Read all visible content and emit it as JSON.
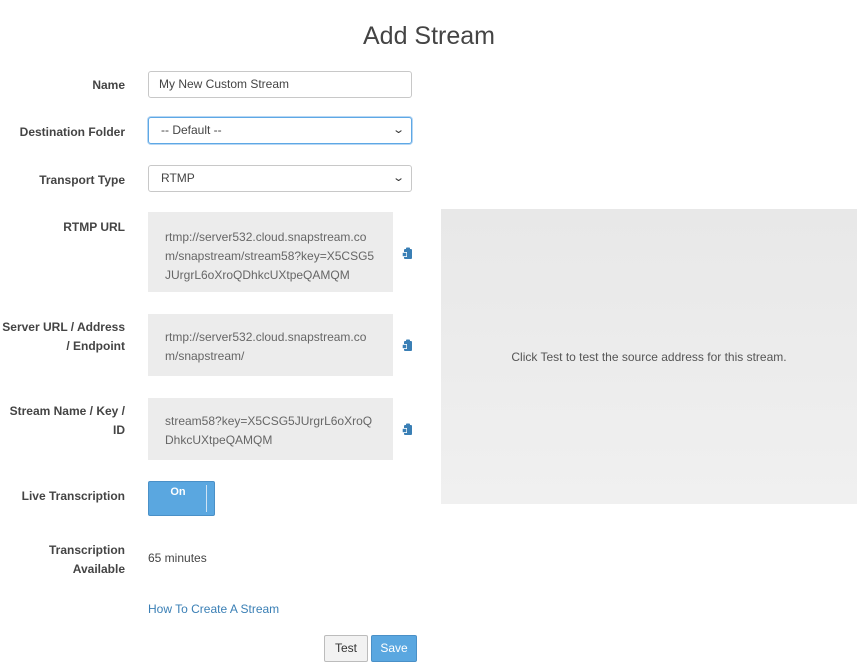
{
  "page": {
    "title": "Add Stream"
  },
  "form": {
    "name": {
      "label": "Name",
      "value": "My New Custom Stream"
    },
    "destination_folder": {
      "label": "Destination Folder",
      "value": "-- Default --"
    },
    "transport_type": {
      "label": "Transport Type",
      "value": "RTMP"
    },
    "rtmp_url": {
      "label": "RTMP URL",
      "value": "rtmp://server532.cloud.snapstream.com/snapstream/stream58?key=X5CSG5JUrgrL6oXroQDhkcUXtpeQAMQM"
    },
    "server_url": {
      "label": "Server URL / Address / Endpoint",
      "value": "rtmp://server532.cloud.snapstream.com/snapstream/"
    },
    "stream_name": {
      "label": "Stream Name / Key / ID",
      "value": "stream58?key=X5CSG5JUrgrL6oXroQDhkcUXtpeQAMQM"
    },
    "live_transcription": {
      "label": "Live Transcription",
      "state": "On"
    },
    "transcription_available": {
      "label": "Transcription Available",
      "value": "65 minutes"
    }
  },
  "preview": {
    "message": "Click Test to test the source address for this stream."
  },
  "links": {
    "how_to": "How To Create A Stream"
  },
  "buttons": {
    "test": "Test",
    "save": "Save"
  },
  "icons": {
    "copy": "clipboard-copy-icon",
    "dropdown": "chevron-down-icon"
  },
  "colors": {
    "accent": "#5aa7e0",
    "link": "#3a7fb5",
    "readonly_bg": "#ececec",
    "preview_bg": "#ebebeb"
  }
}
